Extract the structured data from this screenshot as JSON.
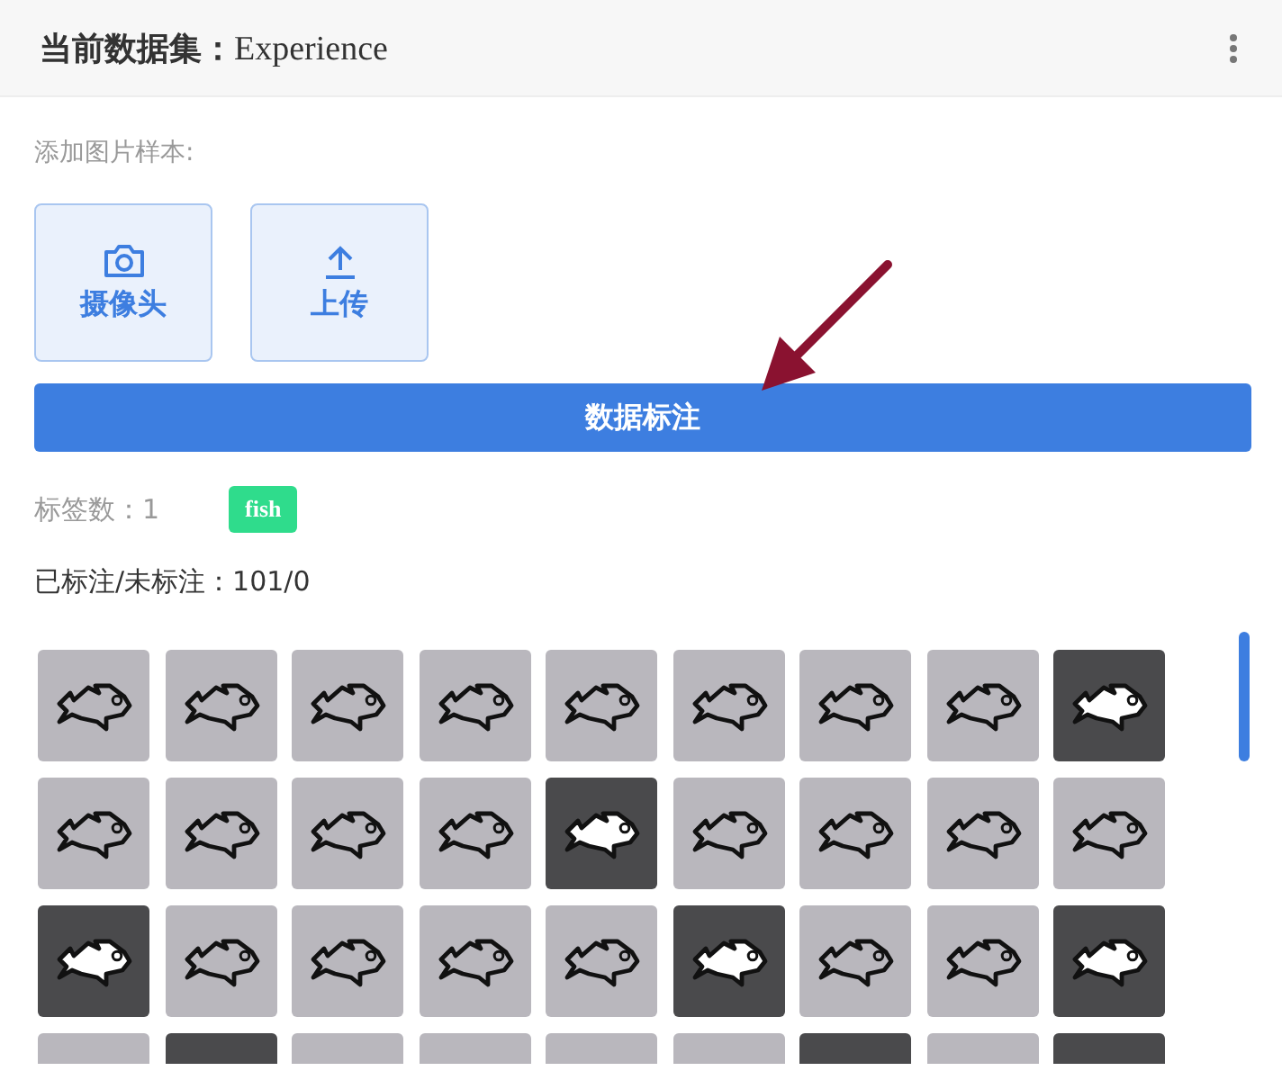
{
  "header": {
    "title": "当前数据集：",
    "dataset": "Experience"
  },
  "add_samples": {
    "label": "添加图片样本:",
    "buttons": [
      {
        "kind": "camera",
        "label": "摄像头"
      },
      {
        "kind": "upload",
        "label": "上传"
      }
    ]
  },
  "annotate_button": "数据标注",
  "labels": {
    "count_label": "标签数：1",
    "tags": [
      {
        "text": "fish",
        "color": "#2fdc8c"
      }
    ]
  },
  "stats": "已标注/未标注：101/0"
}
